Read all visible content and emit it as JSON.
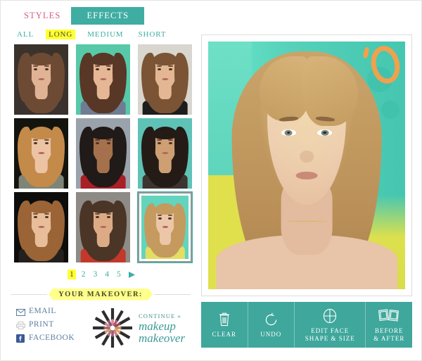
{
  "app": {
    "accent_teal": "#3fada2",
    "accent_pink": "#d4607f",
    "highlight_yellow": "#ffff33",
    "link_blue": "#5b7e9e"
  },
  "tabs": [
    {
      "id": "styles",
      "label": "STYLES",
      "active": false
    },
    {
      "id": "effects",
      "label": "EFFECTS",
      "active": true
    }
  ],
  "filters": [
    {
      "id": "all",
      "label": "ALL",
      "active": false
    },
    {
      "id": "long",
      "label": "LONG",
      "active": true
    },
    {
      "id": "medium",
      "label": "MEDIUM",
      "active": false
    },
    {
      "id": "short",
      "label": "SHORT",
      "active": false
    }
  ],
  "thumbnails": [
    {
      "index": 1,
      "name": "hairstyle-thumb-1",
      "selected": false,
      "bg": "#3b322c",
      "hair": "#6d4a33",
      "skin": "#e0b394",
      "body": "#3a3330",
      "accent": "#cfc6b6"
    },
    {
      "index": 2,
      "name": "hairstyle-thumb-2",
      "selected": false,
      "bg": "#57c9a8",
      "hair": "#593726",
      "skin": "#e5b795",
      "body": "#6f7d94",
      "accent": "#f2e36a"
    },
    {
      "index": 3,
      "name": "hairstyle-thumb-3",
      "selected": false,
      "bg": "#d9d6cf",
      "hair": "#7a5434",
      "skin": "#e3b793",
      "body": "#1d1d1d",
      "accent": "#bdbab2"
    },
    {
      "index": 4,
      "name": "hairstyle-thumb-4",
      "selected": false,
      "bg": "#14140f",
      "hair": "#c48a4a",
      "skin": "#ecc4a4",
      "body": "#7e8577",
      "accent": "#2a2a22"
    },
    {
      "index": 5,
      "name": "hairstyle-thumb-5",
      "selected": false,
      "bg": "#9aa3ac",
      "hair": "#201a18",
      "skin": "#a5714c",
      "body": "#a81f28",
      "accent": "#c3ccd4"
    },
    {
      "index": 6,
      "name": "hairstyle-thumb-6",
      "selected": false,
      "bg": "#5fc2b6",
      "hair": "#241b17",
      "skin": "#cf9f74",
      "body": "#3b3430",
      "accent": "#76cfc2"
    },
    {
      "index": 7,
      "name": "hairstyle-thumb-7",
      "selected": false,
      "bg": "#0d0d0c",
      "hair": "#9a6436",
      "skin": "#e8bd9a",
      "body": "#24201d",
      "accent": "#cfc6b2"
    },
    {
      "index": 8,
      "name": "hairstyle-thumb-8",
      "selected": false,
      "bg": "#8e8b86",
      "hair": "#4a3526",
      "skin": "#dcab86",
      "body": "#c2392c",
      "accent": "#b4b0aa"
    },
    {
      "index": 9,
      "name": "hairstyle-thumb-9",
      "selected": true,
      "bg": "#63d4bd",
      "hair": "#c49a5e",
      "skin": "#ecc6a8",
      "body": "#e3dd62",
      "accent": "#e0e05a"
    }
  ],
  "pagination": {
    "pages": [
      "1",
      "2",
      "3",
      "4",
      "5"
    ],
    "current": "1",
    "next_icon": "triangle-right-icon"
  },
  "makeover_banner": {
    "label": "YOUR MAKEOVER:"
  },
  "share_links": [
    {
      "id": "email",
      "label": "EMAIL",
      "icon": "envelope-icon"
    },
    {
      "id": "print",
      "label": "PRINT",
      "icon": "printer-icon"
    },
    {
      "id": "facebook",
      "label": "FACEBOOK",
      "icon": "facebook-icon"
    }
  ],
  "continue": {
    "label": "CONTINUE »",
    "logo_line1": "makeup",
    "logo_line2": "makeover",
    "burst_icon": "lipstick-burst-icon"
  },
  "photo": {
    "name": "makeover-preview-photo",
    "subject": "blonde-woman-portrait",
    "background_color": "#57d4bb",
    "accent_color": "#f0a14e"
  },
  "toolbar": [
    {
      "id": "clear",
      "label": "CLEAR",
      "icon": "trash-icon",
      "wide": false
    },
    {
      "id": "undo",
      "label": "UNDO",
      "icon": "undo-icon",
      "wide": false
    },
    {
      "id": "edit-face",
      "label": "EDIT FACE\nSHAPE & SIZE",
      "label_line1": "EDIT FACE",
      "label_line2": "SHAPE & SIZE",
      "icon": "face-ellipse-icon",
      "wide": true
    },
    {
      "id": "before-after",
      "label": "BEFORE\n& AFTER",
      "label_line1": "BEFORE",
      "label_line2": "& AFTER",
      "icon": "two-photos-icon",
      "wide": false
    }
  ]
}
